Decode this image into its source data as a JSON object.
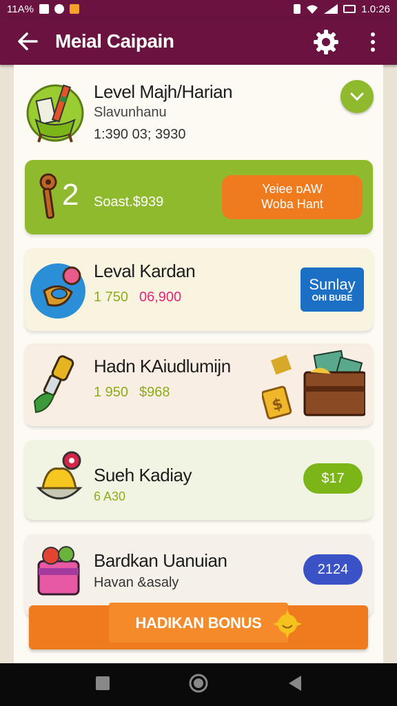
{
  "status": {
    "left": "11A%",
    "time": "1.0:26"
  },
  "appbar": {
    "title": "Meial Caipain"
  },
  "header": {
    "title": "Level Majh/Harian",
    "subtitle": "Slavunhanu",
    "value": "1:390 03; 3930"
  },
  "promo": {
    "number": "2",
    "value": "Soast.$939",
    "button_line1": "Yeiee ɒAW",
    "button_line2": "Woba Hant"
  },
  "items": [
    {
      "title": "Leval Kardan",
      "value_a": "1 750",
      "value_b": "06,900",
      "badge_line1": "Sunlay",
      "badge_line2": "OHI BUBE"
    },
    {
      "title": "Hadn KAiudlumijn",
      "value_a": "1 950",
      "value_b": "$968"
    },
    {
      "title": "Sueh Kadiay",
      "value": "6 A30",
      "badge": "$17"
    },
    {
      "title": "Bardkan Uanuian",
      "subtitle": "Havan &asaly",
      "badge": "2124"
    }
  ],
  "bonus": {
    "label": "HADIKAN BONUS"
  },
  "colors": {
    "brand": "#6a1240",
    "lime": "#8fba2e",
    "orange": "#f07a1e",
    "blue": "#1b6fc4"
  }
}
